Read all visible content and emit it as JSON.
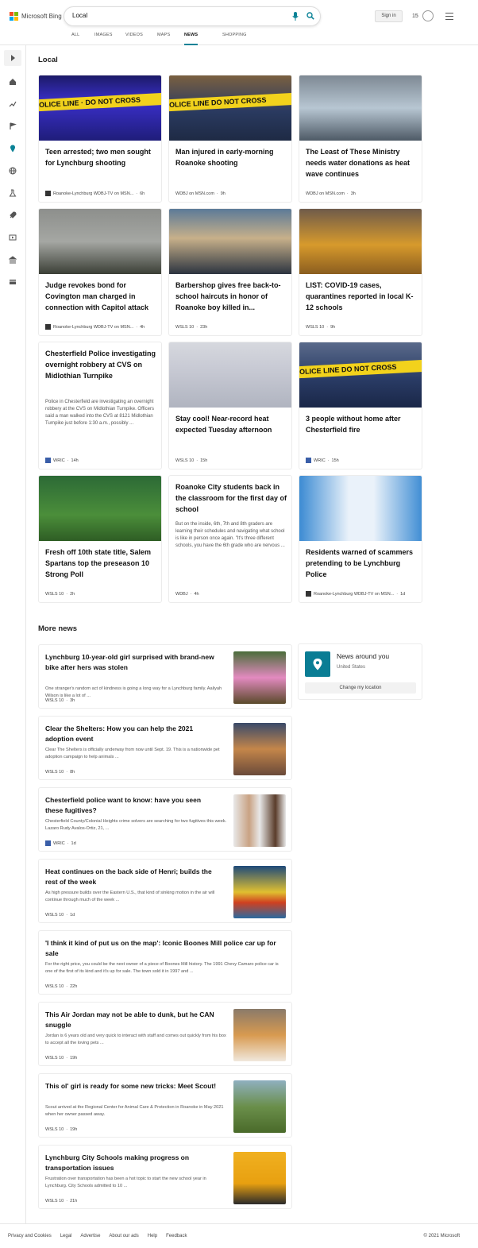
{
  "header": {
    "logo_text": "Microsoft Bing",
    "search_value": "Local",
    "sign_in_label": "Sign in",
    "rewards_count": "15"
  },
  "tabs": [
    "ALL",
    "IMAGES",
    "VIDEOS",
    "MAPS",
    "NEWS",
    "SHOPPING"
  ],
  "active_tab": "NEWS",
  "sidebar_icons": [
    "home-icon",
    "trending-icon",
    "flag-icon",
    "location-icon",
    "globe-icon",
    "science-icon",
    "rocket-icon",
    "video-icon",
    "bank-icon",
    "card-icon"
  ],
  "local": {
    "title": "Local",
    "cards": [
      {
        "title": "Teen arrested; two men sought for Lynchburg shooting",
        "source": "Roanoke-Lynchburg WDBJ-TV on MSN...",
        "time": "6h",
        "snippet": "",
        "logo": true
      },
      {
        "title": "Man injured in early-morning Roanoke shooting",
        "source": "WDBJ on MSN.com",
        "time": "9h",
        "snippet": "",
        "logo": false
      },
      {
        "title": "The Least of These Ministry needs water donations as heat wave continues",
        "source": "WDBJ on MSN.com",
        "time": "3h",
        "snippet": "",
        "logo": false
      },
      {
        "title": "Judge revokes bond for Covington man charged in connection with Capitol attack",
        "source": "Roanoke-Lynchburg WDBJ-TV on MSN...",
        "time": "4h",
        "snippet": "",
        "logo": true
      },
      {
        "title": "Barbershop gives free back-to-school haircuts in honor of Roanoke boy killed in...",
        "source": "WSLS 10",
        "time": "23h",
        "snippet": "",
        "logo": false
      },
      {
        "title": "LIST: COVID-19 cases, quarantines reported in local K-12 schools",
        "source": "WSLS 10",
        "time": "9h",
        "snippet": "",
        "logo": false
      },
      {
        "title": "Chesterfield Police investigating overnight robbery at CVS on Midlothian Turnpike",
        "source": "WRIC",
        "time": "14h",
        "snippet": "Police in Chesterfield are investigating an overnight robbery at the CVS on Midlothian Turnpike. Officers said a man walked into the CVS at 8121 Midlothian Turnpike just before 1:30 a.m., possibly ...",
        "logo": true
      },
      {
        "title": "Stay cool! Near-record heat expected Tuesday afternoon",
        "source": "WSLS 10",
        "time": "15h",
        "snippet": "",
        "logo": false
      },
      {
        "title": "3 people without home after Chesterfield fire",
        "source": "WRIC",
        "time": "15h",
        "snippet": "",
        "logo": true
      },
      {
        "title": "Fresh off 10th state title, Salem Spartans top the preseason 10 Strong Poll",
        "source": "WSLS 10",
        "time": "2h",
        "snippet": "",
        "logo": false
      },
      {
        "title": "Roanoke City students back in the classroom for the first day of school",
        "source": "WDBJ",
        "time": "4h",
        "snippet": "But on the inside, 6th, 7th and 8th graders are learning their schedules and navigating what school is like in person once again. \"It's three different schools, you have the 6th grade who are nervous ...",
        "logo": false
      },
      {
        "title": "Residents warned of scammers pretending to be Lynchburg Police",
        "source": "Roanoke-Lynchburg WDBJ-TV on MSN...",
        "time": "1d",
        "snippet": "",
        "logo": true
      }
    ]
  },
  "more_news": {
    "title": "More news",
    "items": [
      {
        "title": "Lynchburg 10-year-old girl surprised with brand-new bike after hers was stolen",
        "snippet": "One stranger's random act of kindness is going a long way for a Lynchburg family. Aaliyah Wilson is like a lot of ...",
        "source": "WSLS 10",
        "time": "3h",
        "logo": false
      },
      {
        "title": "Clear the Shelters: How you can help the 2021 adoption event",
        "snippet": "Clear The Shelters is officially underway from now until Sept. 19. This is a nationwide pet adoption campaign to help animals ...",
        "source": "WSLS 10",
        "time": "8h",
        "logo": false
      },
      {
        "title": "Chesterfield police want to know: have you seen these fugitives?",
        "snippet": "Chesterfield County/Colonial Heights crime solvers are searching for two fugitives this week. Lazaro Rudy Avalos-Ortiz, 21, ...",
        "source": "WRIC",
        "time": "1d",
        "logo": true
      },
      {
        "title": "Heat continues on the back side of Henri; builds the rest of the week",
        "snippet": "As high pressure builds over the Eastern U.S., that kind of sinking motion in the air will continue through much of the week ...",
        "source": "WSLS 10",
        "time": "1d",
        "logo": false
      },
      {
        "title": "'I think it kind of put us on the map': Iconic Boones Mill police car up for sale",
        "snippet": "For the right price, you could be the next owner of a piece of Boones Mill history. The 1991 Chevy Camaro police car is one of the first of its kind and it's up for sale. The town sold it in 1997 and ...",
        "source": "WSLS 10",
        "time": "22h",
        "logo": false
      },
      {
        "title": "This Air Jordan may not be able to dunk, but he CAN snuggle",
        "snippet": "Jordan is 6 years old and very quick to interact with staff and comes out quickly from his box to accept all the loving pets ...",
        "source": "WSLS 10",
        "time": "19h",
        "logo": false
      },
      {
        "title": "This ol' girl is ready for some new tricks: Meet Scout!",
        "snippet": "Scout arrived at the Regional Center for Animal Care & Protection in Roanoke in May 2021 when her owner passed away.",
        "source": "WSLS 10",
        "time": "19h",
        "logo": false
      },
      {
        "title": "Lynchburg City Schools making progress on transportation issues",
        "snippet": "Frustration over transportation has been a hot topic to start the new school year in Lynchburg. City Schools admitted to 10 ...",
        "source": "WSLS 10",
        "time": "21h",
        "logo": false
      }
    ]
  },
  "around": {
    "title": "News around you",
    "location": "United States",
    "change_label": "Change my location"
  },
  "footer": {
    "links": [
      "Privacy and Cookies",
      "Legal",
      "Advertise",
      "About our ads",
      "Help",
      "Feedback"
    ],
    "copyright": "© 2021 Microsoft"
  },
  "colors": {
    "accent": "#0a8296",
    "border": "#ececec"
  }
}
